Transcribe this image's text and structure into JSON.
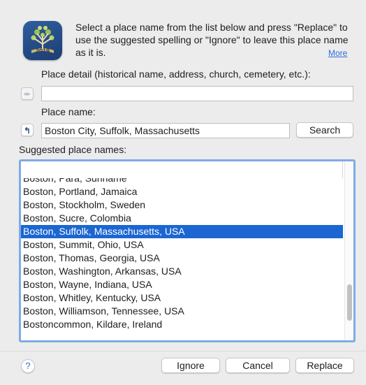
{
  "intro": {
    "message": "Select a place name from the list below and press \"Replace\" to use the suggested spelling or \"Ignore\" to leave this place name as it is.",
    "more_link": "More",
    "icon_year": "2019"
  },
  "place_detail": {
    "label": "Place detail (historical name, address, church, cemetery, etc.):",
    "value": ""
  },
  "place_name": {
    "label": "Place name:",
    "value": "Boston City, Suffolk, Massachusetts",
    "search_button": "Search"
  },
  "suggestions": {
    "label": "Suggested place names:",
    "items": [
      "Boston, Para, Suriname",
      "Boston, Portland, Jamaica",
      "Boston, Stockholm, Sweden",
      "Boston, Sucre, Colombia",
      "Boston, Suffolk, Massachusetts, USA",
      "Boston, Summit, Ohio, USA",
      "Boston, Thomas, Georgia, USA",
      "Boston, Washington, Arkansas, USA",
      "Boston, Wayne, Indiana, USA",
      "Boston, Whitley, Kentucky, USA",
      "Boston, Williamson, Tennessee, USA",
      "Bostoncommon, Kildare, Ireland"
    ],
    "selected_index": 4
  },
  "footer": {
    "help": "?",
    "ignore": "Ignore",
    "cancel": "Cancel",
    "replace": "Replace"
  },
  "colors": {
    "selection": "#1b66d1",
    "focus_ring": "#7fabe8",
    "link": "#2e6ed9"
  }
}
